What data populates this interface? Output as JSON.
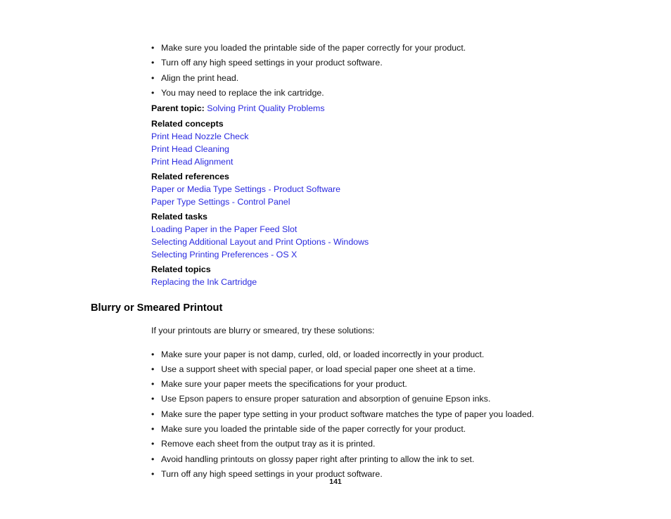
{
  "document": {
    "page_number": "141",
    "link_color": "#2a2ae0",
    "text_color": "#141414"
  },
  "top_section": {
    "solutions": [
      "Make sure you loaded the printable side of the paper correctly for your product.",
      "Turn off any high speed settings in your product software.",
      "Align the print head.",
      "You may need to replace the ink cartridge."
    ],
    "parent_topic": {
      "label": "Parent topic:",
      "link": "Solving Print Quality Problems"
    },
    "related": [
      {
        "heading": "Related concepts",
        "links": [
          "Print Head Nozzle Check",
          "Print Head Cleaning",
          "Print Head Alignment"
        ]
      },
      {
        "heading": "Related references",
        "links": [
          "Paper or Media Type Settings - Product Software",
          "Paper Type Settings - Control Panel"
        ]
      },
      {
        "heading": "Related tasks",
        "links": [
          "Loading Paper in the Paper Feed Slot",
          "Selecting Additional Layout and Print Options - Windows",
          "Selecting Printing Preferences - OS X"
        ]
      },
      {
        "heading": "Related topics",
        "links": [
          "Replacing the Ink Cartridge"
        ]
      }
    ]
  },
  "blurry_section": {
    "heading": "Blurry or Smeared Printout",
    "intro": "If your printouts are blurry or smeared, try these solutions:",
    "solutions": [
      "Make sure your paper is not damp, curled, old, or loaded incorrectly in your product.",
      "Use a support sheet with special paper, or load special paper one sheet at a time.",
      "Make sure your paper meets the specifications for your product.",
      "Use Epson papers to ensure proper saturation and absorption of genuine Epson inks.",
      "Make sure the paper type setting in your product software matches the type of paper you loaded.",
      "Make sure you loaded the printable side of the paper correctly for your product.",
      "Remove each sheet from the output tray as it is printed.",
      "Avoid handling printouts on glossy paper right after printing to allow the ink to set.",
      "Turn off any high speed settings in your product software."
    ]
  },
  "icons": {
    "bullet": "•"
  }
}
